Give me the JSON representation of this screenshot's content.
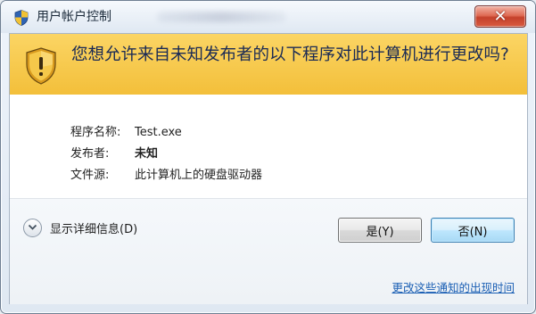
{
  "window": {
    "title": "用户帐户控制",
    "close_icon": "close-icon"
  },
  "banner": {
    "icon": "uac-shield-icon",
    "question": "您想允许来自未知发布者的以下程序对此计算机进行更改吗?"
  },
  "info": {
    "program_name_label": "程序名称:",
    "program_name_value": "Test.exe",
    "publisher_label": "发布者:",
    "publisher_value": "未知",
    "file_source_label": "文件源:",
    "file_source_value": "此计算机上的硬盘驱动器"
  },
  "footer": {
    "details_label": "显示详细信息(D)",
    "details_icon": "chevron-down-icon",
    "yes_label": "是(Y)",
    "no_label": "否(N)",
    "notify_link": "更改这些通知的出现时间"
  },
  "colors": {
    "banner": "#f3bf3a",
    "link": "#1b5fb4",
    "close_button": "#c5412b"
  }
}
